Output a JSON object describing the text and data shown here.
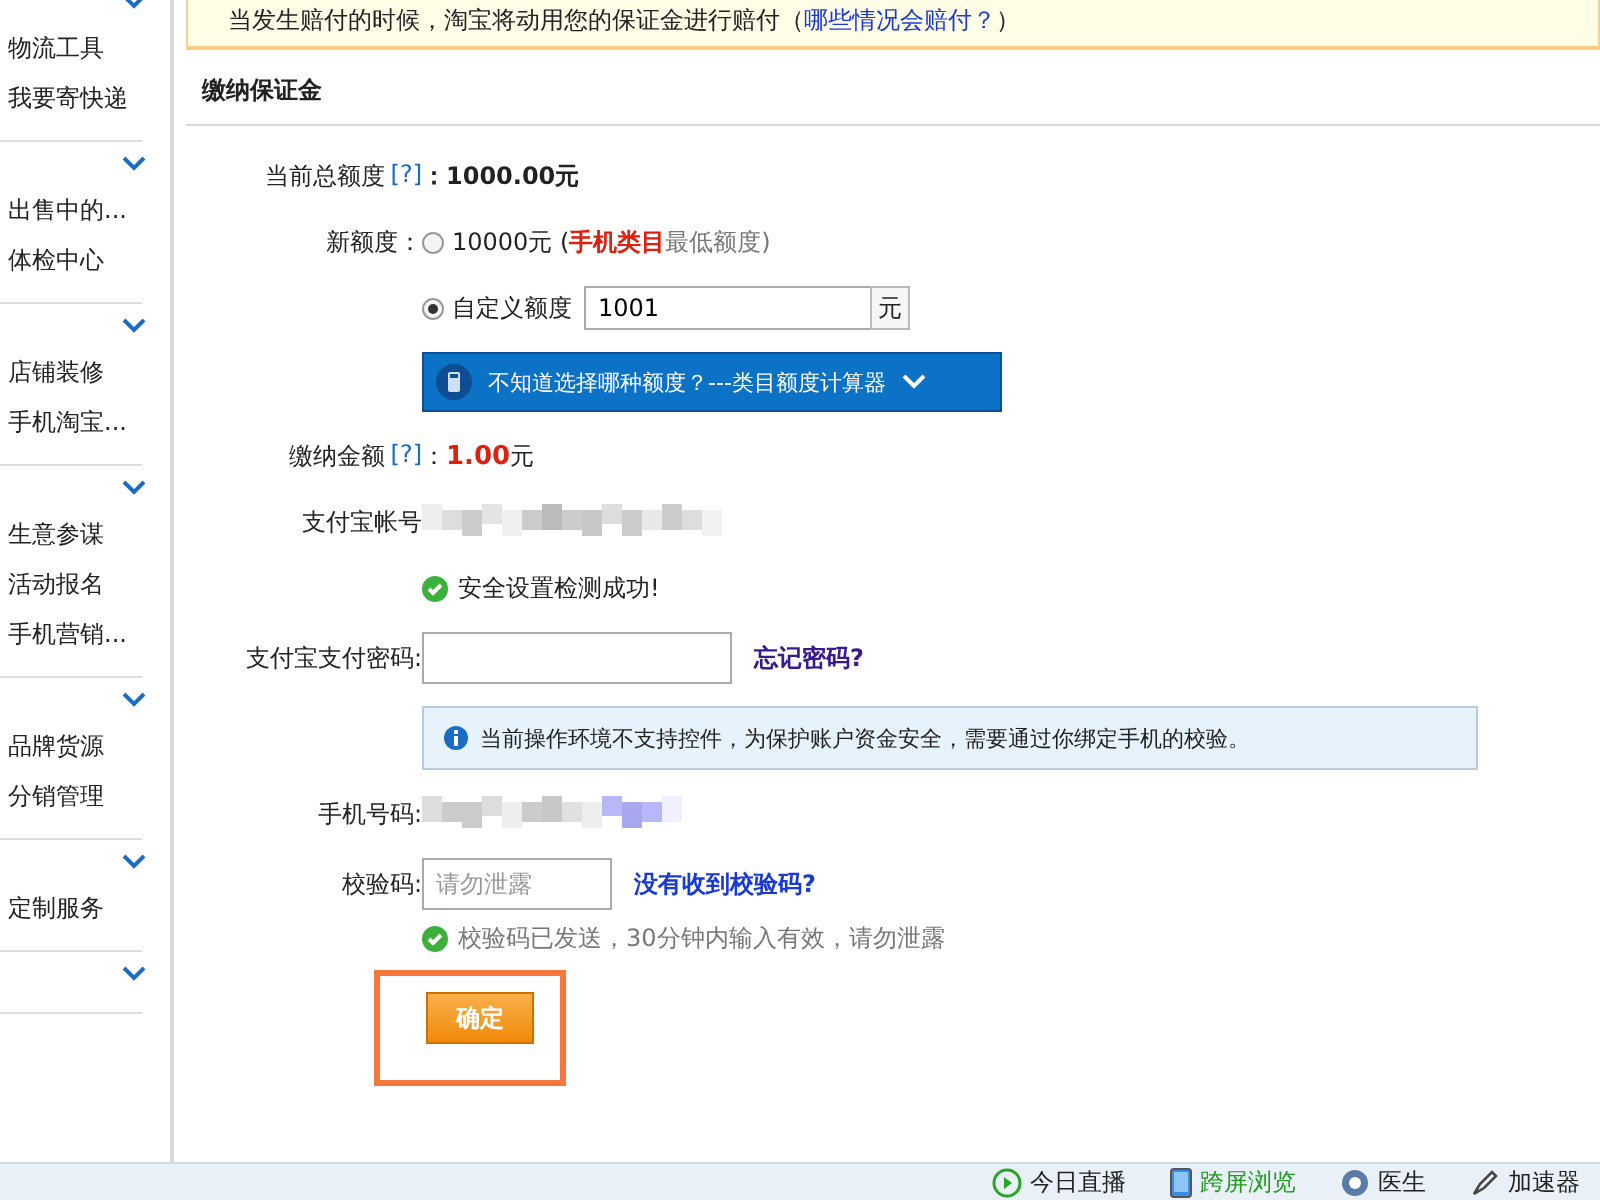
{
  "sidebar": {
    "groups": [
      {
        "expanded": true,
        "items": [
          "物流工具",
          "我要寄快递"
        ]
      },
      {
        "expanded": true,
        "items": [
          "出售中的...",
          "体检中心"
        ]
      },
      {
        "expanded": true,
        "items": [
          "店铺装修",
          "手机淘宝..."
        ]
      },
      {
        "expanded": true,
        "items": [
          "生意参谋",
          "活动报名",
          "手机营销..."
        ]
      },
      {
        "expanded": true,
        "items": [
          "品牌货源",
          "分销管理"
        ]
      },
      {
        "expanded": true,
        "items": [
          "定制服务"
        ]
      },
      {
        "expanded": true
      }
    ]
  },
  "notice": {
    "text": "当发生赔付的时候，淘宝将动用您的保证金进行赔付（",
    "link": "哪些情况会赔付？",
    "tail": "）"
  },
  "section_title": "缴纳保证金",
  "current_quota": {
    "label": "当前总额度",
    "help": "[?]",
    "value": "：1000.00元"
  },
  "new_quota": {
    "label": "新额度：",
    "options": [
      {
        "kind": "preset",
        "selected": false,
        "amount": "10000元 (",
        "highlight": "手机类目",
        "note": "最低额度)"
      },
      {
        "kind": "custom",
        "selected": true,
        "label": "自定义额度",
        "value": "1001",
        "unit": "元"
      }
    ]
  },
  "calculator_button": "不知道选择哪种额度？---类目额度计算器",
  "pay_amount": {
    "label": "缴纳金额",
    "help": "[?]",
    "colon": "：",
    "value": "1.00",
    "unit": "元"
  },
  "alipay_account": {
    "label": "支付宝帐号"
  },
  "security_ok": "安全设置检测成功!",
  "password": {
    "label": "支付宝支付密码:",
    "link": "忘记密码?"
  },
  "info": "当前操作环境不支持控件，为保护账户资金安全，需要通过你绑定手机的校验。",
  "phone": {
    "label": "手机号码:"
  },
  "code": {
    "label": "校验码:",
    "placeholder": "请勿泄露",
    "link": "没有收到校验码?",
    "sent": "校验码已发送，30分钟内输入有效，请勿泄露"
  },
  "confirm_button": "确定",
  "highlighted": true,
  "status_bar": [
    {
      "kind": "live",
      "text": "今日直播"
    },
    {
      "kind": "screen",
      "text": "跨屏浏览"
    },
    {
      "kind": "doctor",
      "text": "医生"
    },
    {
      "kind": "speed",
      "text": "加速器"
    }
  ]
}
